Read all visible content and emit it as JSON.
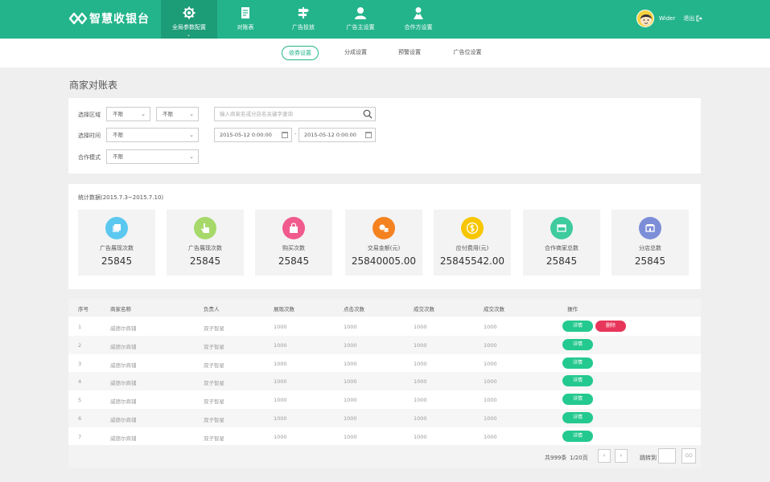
{
  "app": {
    "logo_text": "智慧收银台"
  },
  "nav": {
    "items": [
      {
        "label": "全局参数配置",
        "icon": "gear-icon"
      },
      {
        "label": "对账表",
        "icon": "document-icon"
      },
      {
        "label": "广告投放",
        "icon": "signpost-icon"
      },
      {
        "label": "广告主设置",
        "icon": "user-icon"
      },
      {
        "label": "合作方设置",
        "icon": "partner-icon"
      }
    ],
    "user_name": "Wider",
    "logout_label": "退出"
  },
  "subnav": {
    "items": [
      "收券设置",
      "分成设置",
      "预警设置",
      "广告位设置"
    ]
  },
  "page_title": "商家对账表",
  "filters": {
    "region_label": "选择区域",
    "region_value_1": "不限",
    "region_value_2": "不限",
    "search_placeholder": "输入商家名或分店名关键字查询",
    "time_label": "选择时间",
    "time_value": "不限",
    "date_start": "2015-05-12 0:00:00",
    "date_end": "2015-05-12 0:00:00",
    "date_separator": "-",
    "mode_label": "合作模式",
    "mode_value": "不限"
  },
  "stats": {
    "title": "统计数据(2015.7.3~2015.7.10)",
    "cards": [
      {
        "label": "广告展现次数",
        "value": "25845",
        "color": "#5bc8f0",
        "icon": "cube-icon"
      },
      {
        "label": "广告展现次数",
        "value": "25845",
        "color": "#a6d96a",
        "icon": "pointer-icon"
      },
      {
        "label": "购买次数",
        "value": "25845",
        "color": "#f05a8c",
        "icon": "bag-icon"
      },
      {
        "label": "交易金额(元)",
        "value": "25840005.00",
        "color": "#f58220",
        "icon": "coins-icon"
      },
      {
        "label": "应付费用(元)",
        "value": "25845542.00",
        "color": "#f7c600",
        "icon": "dollar-icon"
      },
      {
        "label": "合作商家总数",
        "value": "25845",
        "color": "#3ecb9d",
        "icon": "shop-icon"
      },
      {
        "label": "分店总数",
        "value": "25845",
        "color": "#7d8ed8",
        "icon": "store-icon"
      }
    ]
  },
  "table": {
    "headers": [
      "序号",
      "商家名称",
      "负责人",
      "展现次数",
      "点击次数",
      "成交次数",
      "成交次数",
      "操作"
    ],
    "detail_label": "详情",
    "delete_label": "删除",
    "rows": [
      [
        "1",
        "威德尔商铺",
        "双子智星",
        "1000",
        "1000",
        "1000",
        "1000"
      ],
      [
        "2",
        "威德尔商铺",
        "双子智星",
        "1000",
        "1000",
        "1000",
        "1000"
      ],
      [
        "3",
        "威德尔商铺",
        "双子智星",
        "1000",
        "1000",
        "1000",
        "1000"
      ],
      [
        "4",
        "威德尔商铺",
        "双子智星",
        "1000",
        "1000",
        "1000",
        "1000"
      ],
      [
        "5",
        "威德尔商铺",
        "双子智星",
        "1000",
        "1000",
        "1000",
        "1000"
      ],
      [
        "6",
        "威德尔商铺",
        "双子智星",
        "1000",
        "1000",
        "1000",
        "1000"
      ],
      [
        "7",
        "威德尔商铺",
        "双子智星",
        "1000",
        "1000",
        "1000",
        "1000"
      ]
    ]
  },
  "pagination": {
    "total": "共999条",
    "pages": "1/20页",
    "prev": "‹",
    "next": "›",
    "jump_label": "跳转到",
    "go_label": "GO"
  }
}
